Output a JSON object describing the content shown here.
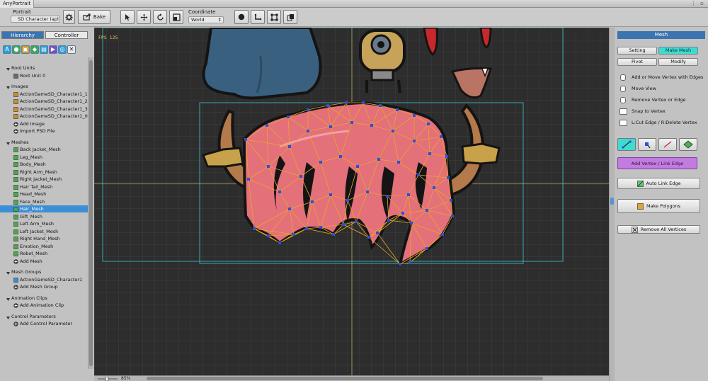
{
  "window": {
    "title": "AnyPortrait"
  },
  "toolbar": {
    "portrait_label": "Portrait",
    "portrait_value": "SD Character (apl",
    "bake_label": "Bake",
    "coordinate_label": "Coordinate",
    "coordinate_value": "World"
  },
  "left_panel": {
    "tabs": [
      {
        "label": "Hierarchy",
        "active": true
      },
      {
        "label": "Controller",
        "active": false
      }
    ],
    "filter_icons": [
      "A",
      "B",
      "C",
      "D",
      "E",
      "F",
      "G",
      "H"
    ],
    "tree": [
      {
        "label": "Root Units",
        "type": "section"
      },
      {
        "label": "Root Unit 0",
        "type": "item"
      },
      {
        "label": "Images",
        "type": "section"
      },
      {
        "label": "ActionGameSD_Character1_1",
        "type": "item"
      },
      {
        "label": "ActionGameSD_Character1_2",
        "type": "item"
      },
      {
        "label": "ActionGameSD_Character1_3",
        "type": "item"
      },
      {
        "label": "ActionGameSD_Character1_0",
        "type": "item"
      },
      {
        "label": "Add Image",
        "type": "add"
      },
      {
        "label": "Import PSD File",
        "type": "add"
      },
      {
        "label": "Meshes",
        "type": "section"
      },
      {
        "label": "Back Jacket_Mesh",
        "type": "item"
      },
      {
        "label": "Leg_Mesh",
        "type": "item"
      },
      {
        "label": "Body_Mesh",
        "type": "item"
      },
      {
        "label": "Right Arm_Mesh",
        "type": "item"
      },
      {
        "label": "Right Jacket_Mesh",
        "type": "item"
      },
      {
        "label": "Hair Tail_Mesh",
        "type": "item"
      },
      {
        "label": "Head_Mesh",
        "type": "item"
      },
      {
        "label": "Face_Mesh",
        "type": "item"
      },
      {
        "label": "Hair_Mesh",
        "type": "item",
        "selected": true
      },
      {
        "label": "Gift_Mesh",
        "type": "item"
      },
      {
        "label": "Left Arm_Mesh",
        "type": "item"
      },
      {
        "label": "Left Jacket_Mesh",
        "type": "item"
      },
      {
        "label": "Right Hand_Mesh",
        "type": "item"
      },
      {
        "label": "Emotion_Mesh",
        "type": "item"
      },
      {
        "label": "Robot_Mesh",
        "type": "item"
      },
      {
        "label": "Add Mesh",
        "type": "add"
      },
      {
        "label": "Mesh Groups",
        "type": "section"
      },
      {
        "label": "ActionGameSD_Character1",
        "type": "item"
      },
      {
        "label": "Add Mesh Group",
        "type": "add"
      },
      {
        "label": "Animation Clips",
        "type": "section"
      },
      {
        "label": "Add Animation Clip",
        "type": "add"
      },
      {
        "label": "Control Parameters",
        "type": "section"
      },
      {
        "label": "Add Control Parameter",
        "type": "add"
      }
    ]
  },
  "viewport": {
    "fps": "FPS 125",
    "zoom": "85%"
  },
  "right_panel": {
    "header": "Mesh",
    "setting_label": "Setting",
    "make_mesh_label": "Make Mesh",
    "pivot_label": "Pivot",
    "modify_label": "Modify",
    "help": [
      "Add or Move Vertex with Edges",
      "Move View",
      "Remove Vertex or Edge",
      "Snap to Vertex",
      "L:Cut Edge / R:Delete Vertex"
    ],
    "add_vertex_label": "Add Vertex / Link Edge",
    "auto_link_label": "Auto Link Edge",
    "make_polygons_label": "Make Polygons",
    "remove_all_label": "Remove All Vertices"
  },
  "colors": {
    "accent_blue": "#3b74b0",
    "active_cyan": "#3ddcd2",
    "purple_button": "#c27ce0",
    "viewport_bg": "#2d2d2d",
    "mesh_edge": "#e0a020",
    "vertex": "#2b4fd8",
    "hair_fill": "#e4707a"
  }
}
